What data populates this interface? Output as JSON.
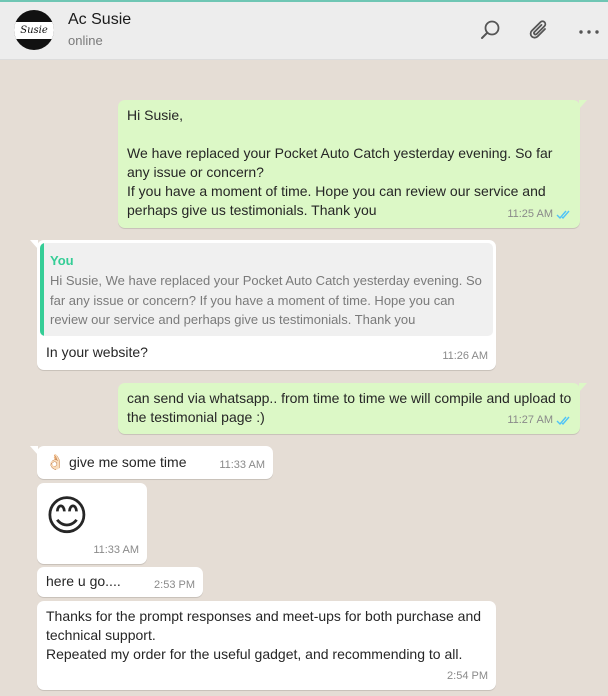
{
  "header": {
    "contact_name": "Ac Susie",
    "status": "online",
    "avatar_text": "Susie",
    "icons": [
      "search-icon",
      "paperclip-icon",
      "more-options-icon"
    ]
  },
  "colors": {
    "outgoing_bubble": "#dcf8c6",
    "incoming_bubble": "#ffffff",
    "chat_background": "#e5ddd5",
    "read_tick": "#4fc3f7",
    "quote_accent": "#35cd96"
  },
  "messages": [
    {
      "direction": "out",
      "text": "Hi Susie,\n\nWe have replaced your Pocket Auto Catch yesterday evening. So far any issue or concern?\nIf you have a moment of time. Hope you can review our service and perhaps give us testimonials. Thank you",
      "time": "11:25 AM",
      "read": true
    },
    {
      "direction": "in",
      "quote": {
        "author": "You",
        "text": "Hi Susie, We have replaced your Pocket Auto Catch yesterday evening. So far any issue or concern? If you have a moment of time. Hope you can review our service and perhaps give us testimonials. Thank you"
      },
      "text": "In your website?",
      "time": "11:26 AM"
    },
    {
      "direction": "out",
      "text": "can send via whatsapp.. from time to time we will compile and upload to the testimonial page :)",
      "time": "11:27 AM",
      "read": true
    },
    {
      "direction": "in",
      "emoji": "👌🏻",
      "text": "give me some time",
      "time": "11:33 AM"
    },
    {
      "direction": "in",
      "emoji": "😊",
      "time": "11:33 AM"
    },
    {
      "direction": "in",
      "text": "here u go....",
      "time": "2:53 PM"
    },
    {
      "direction": "in",
      "text": "Thanks for the prompt responses and meet-ups for both purchase and technical support.\nRepeated my order for the useful gadget, and recommending to all.",
      "time": "2:54 PM"
    }
  ]
}
